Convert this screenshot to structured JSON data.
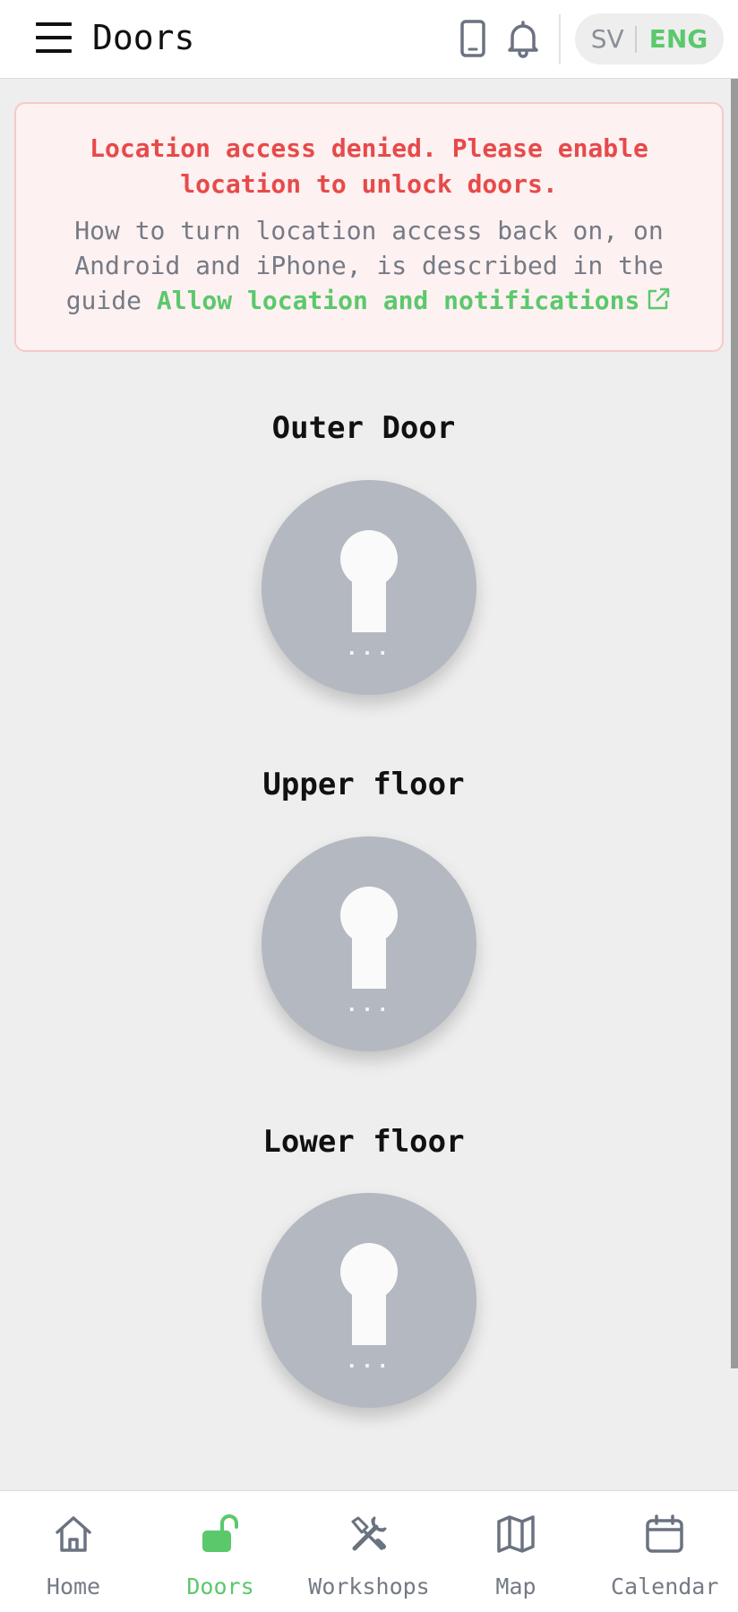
{
  "header": {
    "title": "Doors",
    "icons": [
      "menu-icon",
      "phone-icon",
      "bell-icon"
    ],
    "language": {
      "sv": "SV",
      "eng": "ENG",
      "selected": "ENG"
    }
  },
  "alert": {
    "title": "Location access denied. Please enable location to unlock doors.",
    "body_prefix": "How to turn location access back on, on Android and iPhone, is described in the guide ",
    "link_text": "Allow location and notifications",
    "link_icon": "external-link-icon"
  },
  "doors": [
    {
      "name": "Outer Door",
      "status": "..."
    },
    {
      "name": "Upper floor",
      "status": "..."
    },
    {
      "name": "Lower floor",
      "status": "..."
    }
  ],
  "nav": {
    "items": [
      {
        "label": "Home",
        "icon": "home-icon"
      },
      {
        "label": "Doors",
        "icon": "unlock-icon",
        "active": true
      },
      {
        "label": "Workshops",
        "icon": "tools-icon"
      },
      {
        "label": "Map",
        "icon": "map-icon"
      },
      {
        "label": "Calendar",
        "icon": "calendar-icon"
      }
    ]
  },
  "colors": {
    "accent": "#5bc86c",
    "error": "#e74a4a",
    "door_button": "#b4b8c1",
    "background": "#eeeeee"
  }
}
